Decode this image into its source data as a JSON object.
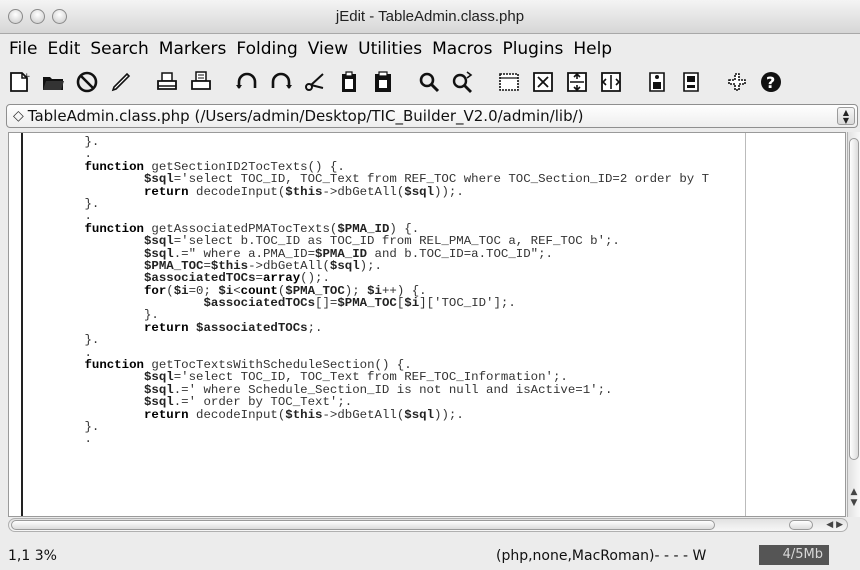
{
  "window": {
    "title": "jEdit - TableAdmin.class.php"
  },
  "menubar": [
    "File",
    "Edit",
    "Search",
    "Markers",
    "Folding",
    "View",
    "Utilities",
    "Macros",
    "Plugins",
    "Help"
  ],
  "toolbar": {
    "buttons": [
      "new-file",
      "open-file",
      "close-buffer",
      "edit",
      "print",
      "print-preview",
      "undo",
      "redo",
      "cut",
      "copy",
      "paste",
      "find",
      "find-next",
      "new-view",
      "split-both",
      "split-horizontal",
      "split-vertical",
      "plugin-manager",
      "global-options",
      "help"
    ]
  },
  "buffer": {
    "path": "TableAdmin.class.php (/Users/admin/Desktop/TIC_Builder_V2.0/admin/lib/)"
  },
  "code": {
    "lines": [
      {
        "text": "        }."
      },
      {
        "text": "        ."
      },
      {
        "text": "        function getSectionID2TocTexts() {."
      },
      {
        "text": "                $sql='select TOC_ID, TOC_Text from REF_TOC where TOC_Section_ID=2 order by T"
      },
      {
        "text": "                return decodeInput($this->dbGetAll($sql));."
      },
      {
        "text": "        }."
      },
      {
        "text": "        ."
      },
      {
        "text": "        function getAssociatedPMATocTexts($PMA_ID) {."
      },
      {
        "text": "                $sql='select b.TOC_ID as TOC_ID from REL_PMA_TOC a, REF_TOC b';."
      },
      {
        "text": "                $sql.=\" where a.PMA_ID=$PMA_ID and b.TOC_ID=a.TOC_ID\";."
      },
      {
        "text": "                $PMA_TOC=$this->dbGetAll($sql);."
      },
      {
        "text": "                $associatedTOCs=array();."
      },
      {
        "text": "                for($i=0; $i<count($PMA_TOC); $i++) {."
      },
      {
        "text": "                        $associatedTOCs[]=$PMA_TOC[$i]['TOC_ID'];."
      },
      {
        "text": "                }."
      },
      {
        "text": "                return $associatedTOCs;."
      },
      {
        "text": "        }."
      },
      {
        "text": "        ."
      },
      {
        "text": "        function getTocTextsWithScheduleSection() {."
      },
      {
        "text": "                $sql='select TOC_ID, TOC_Text from REF_TOC_Information';."
      },
      {
        "text": "                $sql.=' where Schedule_Section_ID is not null and isActive=1';."
      },
      {
        "text": "                $sql.=' order by TOC_Text';."
      },
      {
        "text": "                return decodeInput($this->dbGetAll($sql));."
      },
      {
        "text": "        }."
      },
      {
        "text": "        ."
      }
    ]
  },
  "status": {
    "position": "1,1 3%",
    "mode": "(php,none,MacRoman)- - - - W",
    "memory": "4/5Mb"
  }
}
